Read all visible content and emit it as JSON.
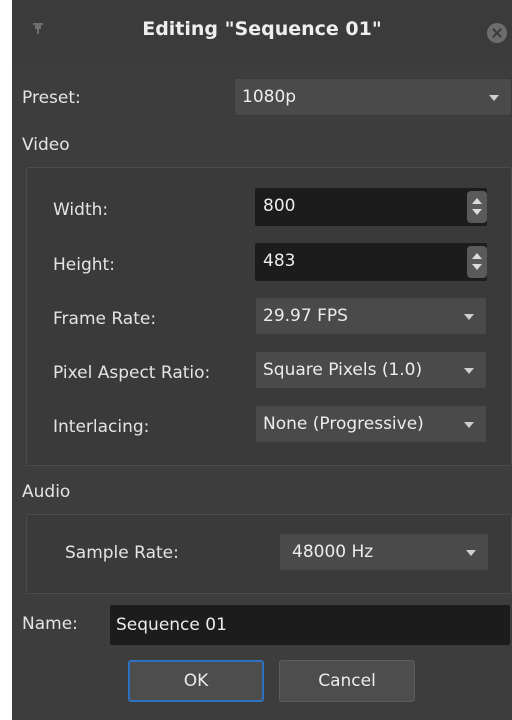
{
  "dialog": {
    "title": "Editing \"Sequence 01\""
  },
  "preset": {
    "label": "Preset:",
    "value": "1080p"
  },
  "video": {
    "section_label": "Video",
    "width_label": "Width:",
    "width_value": "800",
    "height_label": "Height:",
    "height_value": "483",
    "frame_rate_label": "Frame Rate:",
    "frame_rate_value": "29.97 FPS",
    "pixel_aspect_label": "Pixel Aspect Ratio:",
    "pixel_aspect_value": "Square Pixels (1.0)",
    "interlacing_label": "Interlacing:",
    "interlacing_value": "None (Progressive)"
  },
  "audio": {
    "section_label": "Audio",
    "sample_rate_label": "Sample Rate:",
    "sample_rate_value": "48000 Hz"
  },
  "name": {
    "label": "Name:",
    "value": "Sequence 01"
  },
  "buttons": {
    "ok": "OK",
    "cancel": "Cancel"
  },
  "icons": {
    "pin": "pin-icon",
    "close": "close-icon",
    "dropdown": "chevron-down-icon",
    "spin": "spin-arrows-icon"
  }
}
